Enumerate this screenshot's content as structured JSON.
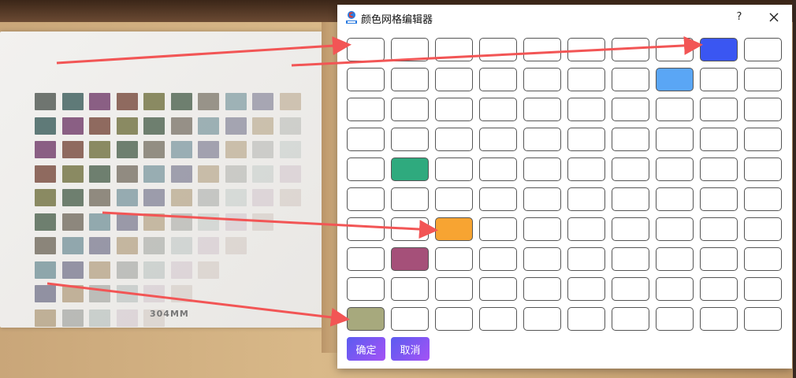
{
  "window": {
    "title": "颜色网格编辑器",
    "help_label": "?",
    "ok_label": "确定",
    "cancel_label": "取消"
  },
  "grid": {
    "rows": 10,
    "cols": 10,
    "filled_cells": [
      {
        "row": 0,
        "col": 8,
        "color": "#3a56f2"
      },
      {
        "row": 1,
        "col": 7,
        "color": "#5aa6f5"
      },
      {
        "row": 4,
        "col": 1,
        "color": "#2faa7e"
      },
      {
        "row": 6,
        "col": 2,
        "color": "#f7a432"
      },
      {
        "row": 7,
        "col": 1,
        "color": "#a55079"
      },
      {
        "row": 9,
        "col": 0,
        "color": "#a7a97d"
      }
    ]
  },
  "photo": {
    "card_label": "304MM"
  },
  "colors": {
    "button_gradient_start": "#5b5cf0",
    "button_gradient_end": "#a452f5",
    "arrow": "#f25555"
  }
}
